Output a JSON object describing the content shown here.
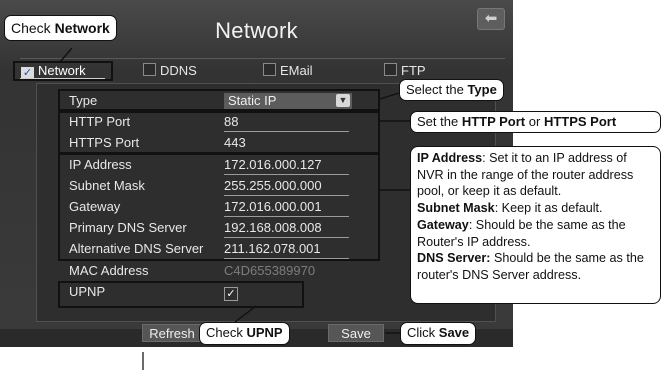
{
  "window": {
    "title": "Network",
    "back_icon": "back-arrow-icon"
  },
  "tabs": [
    {
      "label": "Network",
      "checked": true
    },
    {
      "label": "DDNS",
      "checked": false
    },
    {
      "label": "EMail",
      "checked": false
    },
    {
      "label": "FTP",
      "checked": false
    }
  ],
  "check_mark": "✓",
  "form": {
    "type": {
      "label": "Type",
      "value": "Static IP"
    },
    "http_port": {
      "label": "HTTP Port",
      "value": "88"
    },
    "https_port": {
      "label": "HTTPS Port",
      "value": "443"
    },
    "ip_address": {
      "label": "IP Address",
      "value": "172.016.000.127"
    },
    "subnet_mask": {
      "label": "Subnet Mask",
      "value": "255.255.000.000"
    },
    "gateway": {
      "label": "Gateway",
      "value": "172.016.000.001"
    },
    "primary_dns": {
      "label": "Primary DNS Server",
      "value": "192.168.008.008"
    },
    "alt_dns": {
      "label": "Alternative DNS Server",
      "value": "211.162.078.001"
    },
    "mac": {
      "label": "MAC Address",
      "value": "C4D655389970"
    },
    "upnp": {
      "label": "UPNP",
      "checked": true
    }
  },
  "buttons": {
    "refresh": "Refresh",
    "save": "Save"
  },
  "annotations": {
    "check_network": {
      "text": "Check ",
      "bold": "Network"
    },
    "select_type": {
      "text": "Select the ",
      "bold": "Type"
    },
    "set_port": {
      "text": "Set the ",
      "bold1": "HTTP Port",
      "mid": " or ",
      "bold2": "HTTPS Port"
    },
    "check_upnp": {
      "text": "Check ",
      "bold": "UPNP"
    },
    "click_save": {
      "text": "Click ",
      "bold": "Save"
    },
    "details": {
      "ip_bold": "IP Address",
      "ip_text": ": Set it to an IP address of NVR in the range of the router address pool, or keep it as default.",
      "subnet_bold": "Subnet Mask",
      "subnet_text": ": Keep it as default.",
      "gateway_bold": "Gateway",
      "gateway_text": ": Should be the same as the Router's IP address.",
      "dns_bold": "DNS Server:",
      "dns_text": " Should be the same as the router's DNS Server address."
    }
  },
  "colors": {
    "screen_bg": "#3a3a3a",
    "checkbox_blue": "#1a50c8",
    "callout_border": "#111111"
  }
}
